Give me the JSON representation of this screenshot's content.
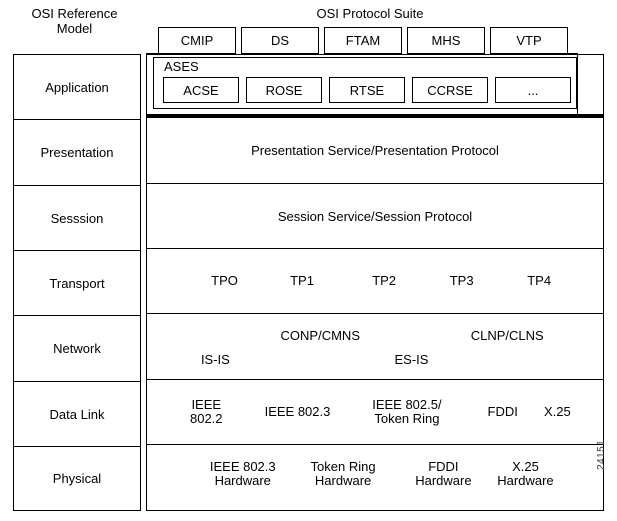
{
  "titles": {
    "left": "OSI Reference\nModel",
    "right": "OSI Protocol Suite"
  },
  "layers": [
    {
      "name": "Application"
    },
    {
      "name": "Presentation"
    },
    {
      "name": "Sesssion"
    },
    {
      "name": "Transport"
    },
    {
      "name": "Network"
    },
    {
      "name": "Data Link"
    },
    {
      "name": "Physical"
    }
  ],
  "application": {
    "top_protocols": [
      "CMIP",
      "DS",
      "FTAM",
      "MHS",
      "VTP"
    ],
    "ases_label": "ASES",
    "ases_elements": [
      "ACSE",
      "ROSE",
      "RTSE",
      "CCRSE",
      "..."
    ]
  },
  "presentation": {
    "text": "Presentation Service/Presentation Protocol"
  },
  "session": {
    "text": "Session Service/Session Protocol"
  },
  "transport": {
    "classes": [
      "TPO",
      "TP1",
      "TP2",
      "TP3",
      "TP4"
    ]
  },
  "network": {
    "upper": [
      "CONP/CMNS",
      "CLNP/CLNS"
    ],
    "lower": [
      "IS-IS",
      "ES-IS"
    ]
  },
  "datalink": {
    "items": [
      "IEEE\n802.2",
      "IEEE 802.3",
      "IEEE 802.5/\nToken Ring",
      "FDDI",
      "X.25"
    ]
  },
  "physical": {
    "items": [
      "IEEE 802.3\nHardware",
      "Token Ring\nHardware",
      "FDDI\nHardware",
      "X.25\nHardware"
    ]
  },
  "figure_id": "24151",
  "colors": {
    "background": "#ffffff",
    "line": "#000000",
    "text": "#000000"
  }
}
